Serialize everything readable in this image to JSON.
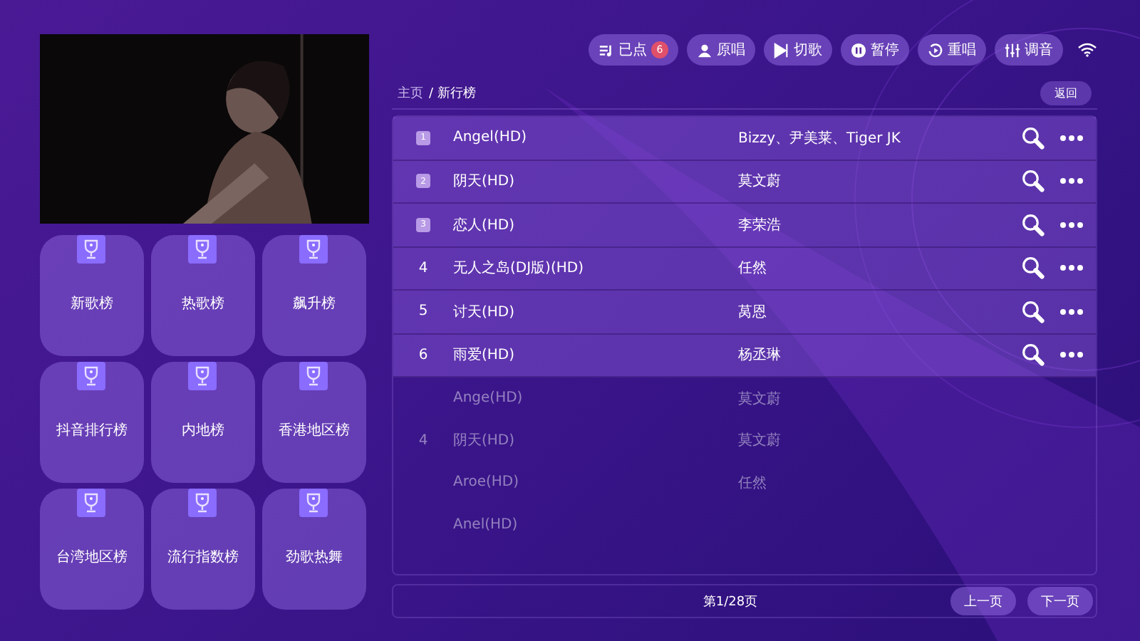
{
  "toolbar": {
    "buttons": [
      {
        "label": "已点",
        "kind": "queue",
        "badge": "6"
      },
      {
        "label": "原唱",
        "kind": "singer"
      },
      {
        "label": "切歌",
        "kind": "skip"
      },
      {
        "label": "暂停",
        "kind": "pause"
      },
      {
        "label": "重唱",
        "kind": "replay"
      },
      {
        "label": "调音",
        "kind": "mixer"
      }
    ]
  },
  "charts": [
    {
      "label": "新歌榜"
    },
    {
      "label": "热歌榜"
    },
    {
      "label": "飙升榜"
    },
    {
      "label": "抖音排行榜"
    },
    {
      "label": "内地榜"
    },
    {
      "label": "香港地区榜"
    },
    {
      "label": "台湾地区榜"
    },
    {
      "label": "流行指数榜"
    },
    {
      "label": "劲歌热舞"
    }
  ],
  "breadcrumb": {
    "home": "主页",
    "current": "/ 新行榜",
    "back": "返回"
  },
  "songs": [
    {
      "rank": "1",
      "badge": true,
      "title": "Angel(HD)",
      "artist": "Bizzy、尹美莱、Tiger JK",
      "faded": false
    },
    {
      "rank": "2",
      "badge": true,
      "title": "阴天(HD)",
      "artist": "莫文蔚",
      "faded": false
    },
    {
      "rank": "3",
      "badge": true,
      "title": "恋人(HD)",
      "artist": "李荣浩",
      "faded": false
    },
    {
      "rank": "4",
      "badge": false,
      "title": "无人之岛(DJ版)(HD)",
      "artist": "任然",
      "faded": false
    },
    {
      "rank": "5",
      "badge": false,
      "title": "讨天(HD)",
      "artist": "莴恩",
      "faded": false
    },
    {
      "rank": "6",
      "badge": false,
      "title": "雨爱(HD)",
      "artist": "杨丞琳",
      "faded": false
    },
    {
      "title": "Ange(HD)",
      "artist": "莫文蔚",
      "faded": true
    },
    {
      "rank": "4",
      "badge": false,
      "title": "阴天(HD)",
      "artist": "莫文蔚",
      "faded": true
    },
    {
      "title": "Aroe(HD)",
      "artist": "任然",
      "faded": true
    },
    {
      "title": "Anel(HD)",
      "faded": true
    }
  ],
  "pagination": {
    "page": "第1/28页",
    "prev": "上一页",
    "next": "下一页"
  }
}
